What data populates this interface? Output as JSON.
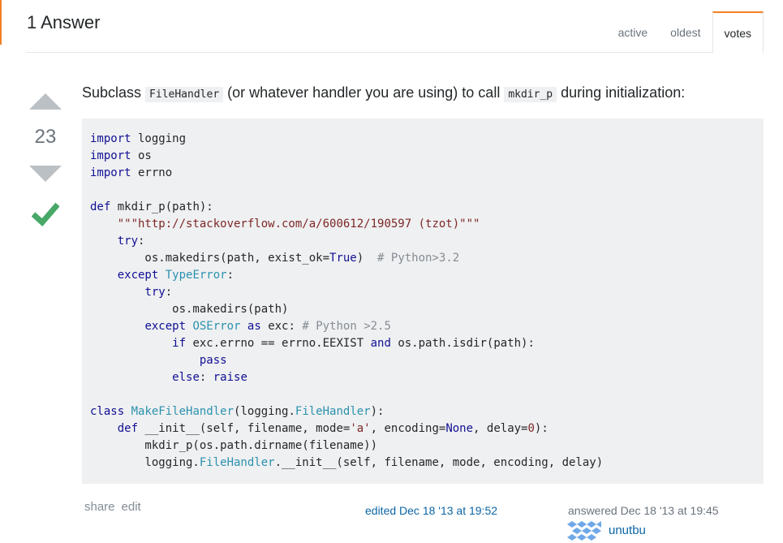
{
  "header": {
    "title": "1 Answer",
    "tabs": [
      {
        "label": "active"
      },
      {
        "label": "oldest"
      },
      {
        "label": "votes",
        "selected": true
      }
    ]
  },
  "answer": {
    "vote_count": "23",
    "accepted": true,
    "intro": {
      "before": "Subclass ",
      "code1": "FileHandler",
      "middle": " (or whatever handler you are using) to call ",
      "code2": "mkdir_p",
      "after": " during initialization:"
    },
    "code_lines": [
      "import logging",
      "import os",
      "import errno",
      "",
      "def mkdir_p(path):",
      "    \"\"\"http://stackoverflow.com/a/600612/190597 (tzot)\"\"\"",
      "    try:",
      "        os.makedirs(path, exist_ok=True)  # Python>3.2",
      "    except TypeError:",
      "        try:",
      "            os.makedirs(path)",
      "        except OSError as exc: # Python >2.5",
      "            if exc.errno == errno.EEXIST and os.path.isdir(path):",
      "                pass",
      "            else: raise",
      "",
      "class MakeFileHandler(logging.FileHandler):",
      "    def __init__(self, filename, mode='a', encoding=None, delay=0):",
      "        mkdir_p(os.path.dirname(filename))",
      "        logging.FileHandler.__init__(self, filename, mode, encoding, delay)"
    ],
    "menu": {
      "share": "share",
      "edit": "edit"
    },
    "edited": "edited Dec 18 '13 at 19:52",
    "answered": "answered Dec 18 '13 at 19:45",
    "user": "unutbu"
  },
  "colors": {
    "accent": "#f48024",
    "link": "#0c65a5",
    "accepted_check": "#48a868",
    "keyword": "#101094",
    "type": "#2b91af",
    "string": "#7d2727",
    "comment": "#858c93"
  }
}
